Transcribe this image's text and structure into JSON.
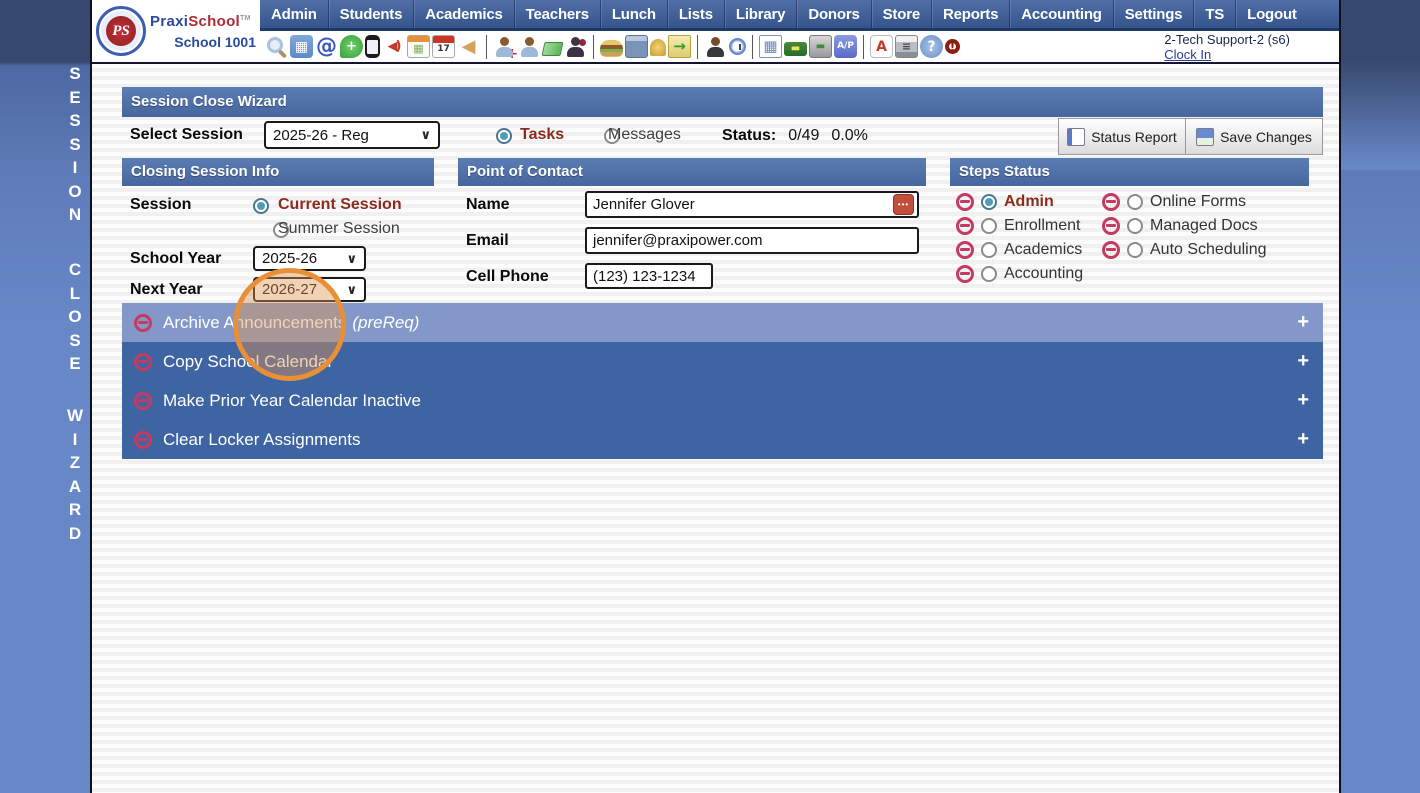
{
  "brand": {
    "monogram": "PS",
    "name_part1": "Praxi",
    "name_part2": "School",
    "trademark": "TM",
    "school_label": "School 1001"
  },
  "nav": {
    "items": [
      "Admin",
      "Students",
      "Academics",
      "Teachers",
      "Lunch",
      "Lists",
      "Library",
      "Donors",
      "Store",
      "Reports",
      "Accounting",
      "Settings",
      "TS",
      "Logout"
    ]
  },
  "toolbar": {
    "groups": [
      [
        "search",
        "calendar-grid",
        "email-at",
        "chat",
        "mobile-phone",
        "speaker",
        "calendar-color",
        "calendar-date",
        "megaphone"
      ],
      [
        "add-person",
        "person",
        "money",
        "family"
      ],
      [
        "lunch-burger",
        "notebook",
        "bell",
        "send-note"
      ],
      [
        "staff-person",
        "alarm-clock"
      ],
      [
        "spreadsheet",
        "payment-card",
        "cash-register",
        "accounts-payable"
      ],
      [
        "pdf",
        "printer",
        "help",
        "stop"
      ]
    ],
    "glyph_map": {
      "calendar-grid": "▦",
      "email-at": "@",
      "chat": "+",
      "speaker": "◀)",
      "calendar-color": "▦",
      "calendar-date": "17",
      "megaphone": "◀",
      "add-person": "+",
      "send-note": "→",
      "spreadsheet": "▦",
      "payment-card": "▬",
      "cash-register": "▬",
      "accounts-payable": "A/P",
      "pdf": "A",
      "printer": "≡",
      "help": "?",
      "stop": "!"
    },
    "user": {
      "name": "2-Tech Support-2 (s6)",
      "clock_link": "Clock In"
    }
  },
  "sidebar": {
    "words": [
      "SESSION",
      "CLOSE",
      "WIZARD"
    ]
  },
  "wizard": {
    "title": "Session Close Wizard",
    "select_session_label": "Select Session",
    "session_value": "2025-26 - Reg",
    "tasks_label": "Tasks",
    "tasks_selected": true,
    "messages_label": "Messages",
    "messages_selected": false,
    "status_label": "Status:",
    "status_count": "0/49",
    "status_percent": "0.0%",
    "status_report_button": "Status Report",
    "save_changes_button": "Save Changes"
  },
  "closing_info": {
    "title": "Closing Session Info",
    "session_label": "Session",
    "current_session": "Current Session",
    "current_selected": true,
    "summer_session": "Summer Session",
    "summer_selected": false,
    "school_year_label": "School Year",
    "school_year_value": "2025-26",
    "next_year_label": "Next Year",
    "next_year_value": "2026-27"
  },
  "contact": {
    "title": "Point of Contact",
    "name_label": "Name",
    "name_value": "Jennifer Glover",
    "more_glyph": "•••",
    "email_label": "Email",
    "email_value": "jennifer@praxipower.com",
    "phone_label": "Cell Phone",
    "phone_value": "(123) 123-1234"
  },
  "steps": {
    "title": "Steps Status",
    "col1": [
      {
        "label": "Admin",
        "selected": true
      },
      {
        "label": "Enrollment",
        "selected": false
      },
      {
        "label": "Academics",
        "selected": false
      },
      {
        "label": "Accounting",
        "selected": false
      }
    ],
    "col2": [
      {
        "label": "Online Forms",
        "selected": false
      },
      {
        "label": "Managed Docs",
        "selected": false
      },
      {
        "label": "Auto Scheduling",
        "selected": false
      }
    ]
  },
  "tasks": {
    "expand_glyph": "+",
    "rows": [
      {
        "label": "Archive Announcements",
        "suffix": "(preReq)",
        "highlighted": true
      },
      {
        "label": "Copy School Calendar",
        "suffix": "",
        "highlighted": false
      },
      {
        "label": "Make Prior Year Calendar Inactive",
        "suffix": "",
        "highlighted": false
      },
      {
        "label": "Clear Locker Assignments",
        "suffix": "",
        "highlighted": false
      }
    ]
  },
  "colors": {
    "nav_blue": "#35548c",
    "panel_header_blue": "#4a70a8",
    "task_blue": "#3e65a2",
    "task_highlight_blue": "#8398c8",
    "no_entry_red": "#c43a60",
    "selected_text_red": "#8c2a1c",
    "highlight_circle_orange": "#e89038",
    "page_background_blue": "#6787c6"
  }
}
